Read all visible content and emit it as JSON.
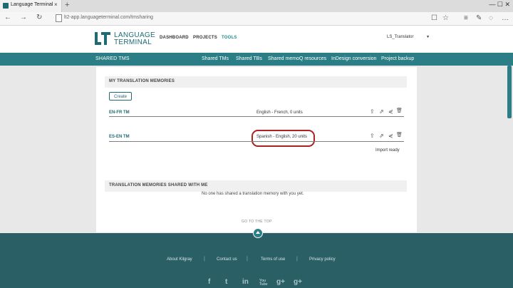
{
  "browser": {
    "tab_title": "Language Terminal",
    "tab_close": "×",
    "new_tab": "+",
    "url": "lt2-app.languageterminal.com/tmsharing",
    "window_controls": "—   ☐   ✕",
    "nav": {
      "back": "←",
      "forward": "→",
      "refresh": "↻"
    },
    "right_icons": {
      "reading": "☐",
      "favorite": "☆",
      "hub": "≡",
      "notes": "✎",
      "share": "◌",
      "more": "…"
    }
  },
  "header": {
    "logo_line1": "LANGUAGE",
    "logo_line2": "TERMINAL",
    "nav": [
      "DASHBOARD",
      "PROJECTS",
      "TOOLS"
    ],
    "active_nav": "TOOLS",
    "user": "LS_Translator",
    "user_caret": "▼"
  },
  "subnav": {
    "title": "SHARED TMS",
    "items": [
      "Shared TMs",
      "Shared TBs",
      "Shared memoQ resources",
      "InDesign conversion",
      "Project backup"
    ]
  },
  "my_tms": {
    "title": "MY TRANSLATION MEMORIES",
    "create_label": "Create",
    "rows": [
      {
        "name": "EN-FR TM",
        "desc": "English - French, 0 units",
        "status": ""
      },
      {
        "name": "ES-EN TM",
        "desc": "Spanish - English, 20 units",
        "status": "Import ready"
      }
    ],
    "actions": {
      "import": "⇪",
      "export": "⇗",
      "share": "⋞",
      "delete": "🗑"
    }
  },
  "shared_tms": {
    "title": "TRANSLATION MEMORIES SHARED WITH ME",
    "empty": "No one has shared a translation memory with you yet."
  },
  "goto_top": "GO TO THE TOP",
  "footer": {
    "links": [
      "About Kilgray",
      "Contact us",
      "Terms of use",
      "Privacy policy"
    ],
    "separator": "|",
    "social": [
      "f",
      "t",
      "in",
      "You Tube",
      "g+"
    ]
  },
  "colors": {
    "teal": "#2b7e86",
    "footer": "#2b5f66",
    "highlight": "#b02020"
  }
}
